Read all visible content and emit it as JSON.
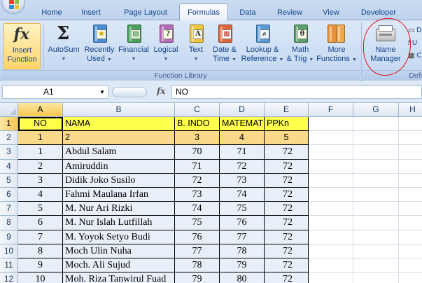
{
  "tabs": [
    {
      "label": "Home",
      "active": false
    },
    {
      "label": "Insert",
      "active": false
    },
    {
      "label": "Page Layout",
      "active": false
    },
    {
      "label": "Formulas",
      "active": true
    },
    {
      "label": "Data",
      "active": false
    },
    {
      "label": "Review",
      "active": false
    },
    {
      "label": "View",
      "active": false
    },
    {
      "label": "Developer",
      "active": false
    }
  ],
  "ribbon": {
    "insert_function": {
      "line1": "Insert",
      "line2": "Function",
      "icon": "fx-icon"
    },
    "autosum": {
      "line1": "AutoSum",
      "icon": "sigma-icon"
    },
    "recently_used": {
      "line1": "Recently",
      "line2": "Used",
      "icon": "star-book-icon"
    },
    "financial": {
      "line1": "Financial",
      "icon": "money-book-icon"
    },
    "logical": {
      "line1": "Logical",
      "icon": "question-book-icon",
      "glyph": "?"
    },
    "text": {
      "line1": "Text",
      "icon": "text-book-icon",
      "glyph": "A"
    },
    "date_time": {
      "line1": "Date &",
      "line2": "Time",
      "icon": "calendar-book-icon"
    },
    "lookup_reference": {
      "line1": "Lookup &",
      "line2": "Reference",
      "icon": "magnifier-book-icon"
    },
    "math_trig": {
      "line1": "Math",
      "line2": "& Trig",
      "icon": "theta-book-icon",
      "glyph": "θ"
    },
    "more_functions": {
      "line1": "More",
      "line2": "Functions",
      "icon": "books-icon"
    },
    "name_manager": {
      "line1": "Name",
      "line2": "Manager",
      "icon": "name-manager-icon"
    },
    "group_function_library": "Function Library",
    "group_defined_partial": "Defi",
    "colors": {
      "text_book": "#f3c63c",
      "logical_book": "#b66bb8",
      "financial_book": "#4aa05a",
      "recent_book": "#4a8fd6",
      "date_book": "#e0673a",
      "lookup_book": "#5b9bd5",
      "math_book": "#5aa06a",
      "more_book": "#e8933a"
    }
  },
  "formula_bar": {
    "name_box": "A1",
    "fx_symbol": "fx",
    "formula": "NO"
  },
  "sheet": {
    "columns": [
      "A",
      "B",
      "C",
      "D",
      "E",
      "F",
      "G",
      "H"
    ],
    "rows": [
      {
        "num": "1",
        "a": "NO",
        "b": "NAMA",
        "c": "B. INDO",
        "d": "MATEMATIKA",
        "e": "PPKn"
      },
      {
        "num": "2",
        "a": "1",
        "b": "2",
        "c": "3",
        "d": "4",
        "e": "5"
      },
      {
        "num": "3",
        "a": "1",
        "b": "Abdul Salam",
        "c": "70",
        "d": "71",
        "e": "72"
      },
      {
        "num": "4",
        "a": "2",
        "b": "Amiruddin",
        "c": "71",
        "d": "72",
        "e": "72"
      },
      {
        "num": "5",
        "a": "3",
        "b": "Didik Joko Susilo",
        "c": "72",
        "d": "73",
        "e": "72"
      },
      {
        "num": "6",
        "a": "4",
        "b": "Fahmi Maulana Irfan",
        "c": "73",
        "d": "74",
        "e": "72"
      },
      {
        "num": "7",
        "a": "5",
        "b": "M. Nur Ari Rizki",
        "c": "74",
        "d": "75",
        "e": "72"
      },
      {
        "num": "8",
        "a": "6",
        "b": "M. Nur Islah Lutfillah",
        "c": "75",
        "d": "76",
        "e": "72"
      },
      {
        "num": "9",
        "a": "7",
        "b": "M. Yoyok Setyo Budi",
        "c": "76",
        "d": "77",
        "e": "72"
      },
      {
        "num": "10",
        "a": "8",
        "b": "Moch Ulin Nuha",
        "c": "77",
        "d": "78",
        "e": "72"
      },
      {
        "num": "11",
        "a": "9",
        "b": "Moch. Ali Sujud",
        "c": "78",
        "d": "79",
        "e": "72"
      },
      {
        "num": "12",
        "a": "10",
        "b": "Moh. Riza Tanwirul Fuad",
        "c": "79",
        "d": "80",
        "e": "72"
      }
    ]
  }
}
